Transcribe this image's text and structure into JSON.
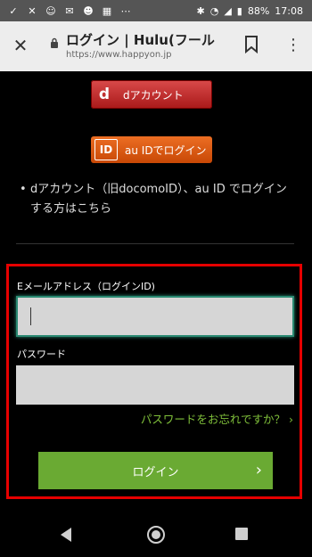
{
  "status_bar": {
    "battery": "88%",
    "time": "17:08"
  },
  "browser": {
    "title": "ログイン | Hulu(フール",
    "url": "https://www.happyon.jp"
  },
  "login_options": {
    "dacc_logo": "d",
    "dacc_label": "dアカウント",
    "au_logo": "ID",
    "au_label": "au IDでログイン",
    "note_bullet": "•",
    "note_text": "dアカウント（旧docomoID）、au ID でログインする方はこちら"
  },
  "form": {
    "email_label": "Eメールアドレス（ログインID)",
    "email_value": "",
    "password_label": "パスワード",
    "password_value": "",
    "forgot_link": "パスワードをお忘れですか？ ›",
    "login_button": "ログイン",
    "login_chevron": "›"
  },
  "colors": {
    "accent_green": "#6aaa33",
    "highlight_red": "#e60000",
    "dacc_red": "#c0282a",
    "au_orange": "#e0601a"
  }
}
